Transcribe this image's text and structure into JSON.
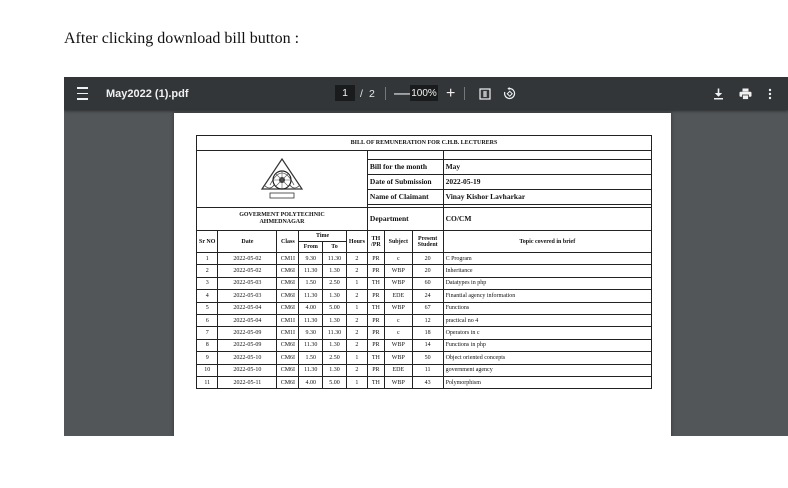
{
  "caption": "After clicking download bill button :",
  "viewer": {
    "file_name": "May2022 (1).pdf",
    "current_page": "1",
    "page_separator": "/",
    "total_pages": "2",
    "zoom_out": "—",
    "zoom_level": "100%",
    "zoom_in": "+"
  },
  "bill": {
    "title": "BILL OF REMUNERATION FOR C.H.B. LECTURERS",
    "college_line1": "GOVERMENT POLYTECHNIC",
    "college_line2": "AHMEDNAGAR",
    "fields": {
      "month_label": "Bill for the month",
      "month_value": "May",
      "submission_label": "Date of Submission",
      "submission_value": "2022-05-19",
      "claimant_label": "Name of Claimant",
      "claimant_value": "Vinay Kishor Lavharkar",
      "department_label": "Department",
      "department_value": "CO/CM"
    },
    "headers": {
      "sr_no": "Sr NO",
      "date": "Date",
      "class": "Class",
      "time": "Time",
      "from": "From",
      "to": "To",
      "hours": "Hours",
      "th_line1": "TH",
      "th_line2": "/PR",
      "subject": "Subject",
      "present_line1": "Present",
      "present_line2": "Student",
      "topic": "Topic covered in brief"
    },
    "rows": [
      [
        "1",
        "2022-05-02",
        "CM1I",
        "9.30",
        "11.30",
        "2",
        "PR",
        "c",
        "20",
        "C Program"
      ],
      [
        "2",
        "2022-05-02",
        "CM6I",
        "11.30",
        "1.30",
        "2",
        "PR",
        "WBP",
        "20",
        "Inheritance"
      ],
      [
        "3",
        "2022-05-03",
        "CM6I",
        "1.50",
        "2.50",
        "1",
        "TH",
        "WBP",
        "60",
        "Datatypes in php"
      ],
      [
        "4",
        "2022-05-03",
        "CM6I",
        "11.30",
        "1.30",
        "2",
        "PR",
        "EDE",
        "24",
        "Finantial agency information"
      ],
      [
        "5",
        "2022-05-04",
        "CM6I",
        "4.00",
        "5.00",
        "1",
        "TH",
        "WBP",
        "67",
        "Functions"
      ],
      [
        "6",
        "2022-05-04",
        "CM1I",
        "11.30",
        "1.30",
        "2",
        "PR",
        "c",
        "12",
        "practical no 4"
      ],
      [
        "7",
        "2022-05-09",
        "CM1I",
        "9.30",
        "11.30",
        "2",
        "PR",
        "c",
        "18",
        "Operators in c"
      ],
      [
        "8",
        "2022-05-09",
        "CM6I",
        "11.30",
        "1.30",
        "2",
        "PR",
        "WBP",
        "14",
        "Functions in php"
      ],
      [
        "9",
        "2022-05-10",
        "CM6I",
        "1.50",
        "2.50",
        "1",
        "TH",
        "WBP",
        "50",
        "Object oriented concepts"
      ],
      [
        "10",
        "2022-05-10",
        "CM6I",
        "11.30",
        "1.30",
        "2",
        "PR",
        "EDE",
        "11",
        "government agency"
      ],
      [
        "11",
        "2022-05-11",
        "CM6I",
        "4.00",
        "5.00",
        "1",
        "TH",
        "WBP",
        "43",
        "Polymorphism"
      ]
    ]
  }
}
